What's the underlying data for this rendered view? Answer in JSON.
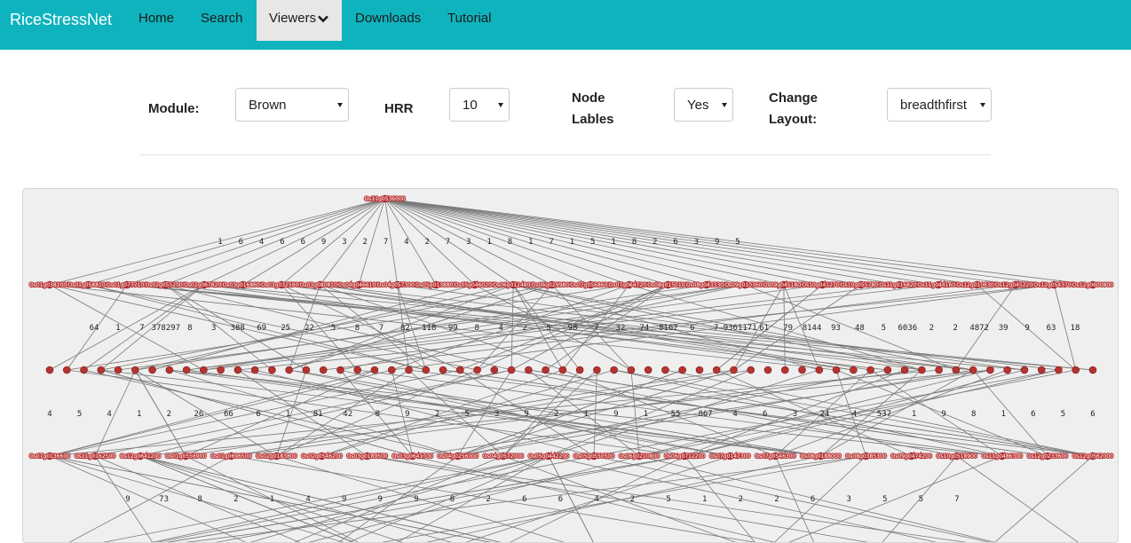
{
  "navbar": {
    "brand": "RiceStressNet",
    "items": [
      {
        "id": "home",
        "label": "Home"
      },
      {
        "id": "search",
        "label": "Search"
      },
      {
        "id": "viewers",
        "label": "Viewers",
        "active": true,
        "dropdown": true
      },
      {
        "id": "downloads",
        "label": "Downloads"
      },
      {
        "id": "tutorial",
        "label": "Tutorial"
      }
    ],
    "color": "#0fb3bd"
  },
  "controls": {
    "module_label": "Module:",
    "module_value": "Brown",
    "hrr_label": "HRR",
    "hrr_value": "10",
    "node_labels_label_line1": "Node",
    "node_labels_label_line2": "Lables",
    "node_labels_value": "Yes",
    "layout_label_line1": "Change",
    "layout_label_line2": "Layout:",
    "layout_value": "breadthfirst"
  },
  "graph": {
    "layout": "breadthfirst",
    "node_color": "#b83232",
    "edge_color": "#7a7a7a",
    "root_label": "Os11g0536000",
    "layer_sizes": [
      1,
      28,
      62,
      24,
      20
    ],
    "layer1_edge_labels": [
      "1",
      "6",
      "4",
      "6",
      "6",
      "9",
      "3",
      "2",
      "7",
      "4",
      "2",
      "7",
      "3",
      "1",
      "8",
      "1",
      "7",
      "1",
      "5",
      "1",
      "8",
      "2",
      "6",
      "3",
      "9",
      "5"
    ],
    "layer1_labels": [
      "Os01g0382000",
      "Os01g0588100",
      "Os01g0777100",
      "Os02g0552000",
      "Os02g0678200",
      "Os03g0168600",
      "Os03g0325900",
      "Os03g0808100",
      "Os04g0466100",
      "Os04g0573000",
      "Os05g0138800",
      "Os05g0460200",
      "Os06g0124800",
      "Os06g0299800",
      "Os07g0568600",
      "Os07g0647200",
      "Os08g0150100",
      "Os08g0433300",
      "Os09g0103600",
      "Os09g0451800",
      "Os10g0412700",
      "Os10g0557800",
      "Os11g0168200",
      "Os11g0441600",
      "Os12g0106300",
      "Os12g0452200",
      "Os12g0543700",
      "Os12g0600800"
    ],
    "layer2_edge_labels": [
      "64",
      "1",
      "7",
      "378297",
      "8",
      "3",
      "388",
      "69",
      "25",
      "22",
      "5",
      "8",
      "7",
      "82",
      "118",
      "99",
      "8",
      "4",
      "2",
      "5",
      "98",
      "7",
      "32",
      "74",
      "8162",
      "6",
      "7",
      "9361171",
      "61",
      "79",
      "8144",
      "93",
      "48",
      "5",
      "6036",
      "2",
      "2",
      "4872",
      "39",
      "9",
      "63",
      "18"
    ],
    "layer3_edge_labels": [
      "4",
      "5",
      "4",
      "1",
      "2",
      "26",
      "66",
      "6",
      "1",
      "81",
      "42",
      "8",
      "9",
      "2",
      "5",
      "3",
      "9",
      "2",
      "1",
      "9",
      "1",
      "55",
      "867",
      "4",
      "6",
      "3",
      "24",
      "4",
      "537",
      "1",
      "9",
      "8",
      "1",
      "6",
      "5",
      "6"
    ],
    "layer3_labels": [
      "Os07g0136600",
      "Os11g0162500",
      "Os12g0641200",
      "Os01g0556900",
      "Os01g0696500",
      "Os02g0183800",
      "Os02g0546200",
      "Os03g0189500",
      "Os03g0641700",
      "Os04g0256000",
      "Os04g0572000",
      "Os05g0442200",
      "Os05g0550500",
      "Os06g0210800",
      "Os06g0712200",
      "Os07g0147300",
      "Os07g0546300",
      "Os08g0188000",
      "Os08g0385300",
      "Os09g0474200",
      "Os10g0518900",
      "Os11g0486300",
      "Os12g0233600",
      "Os12g0562000"
    ],
    "layer4_edge_labels": [
      "9",
      "73",
      "8",
      "2",
      "1",
      "4",
      "9",
      "9",
      "9",
      "8",
      "2",
      "6",
      "6",
      "4",
      "2",
      "5",
      "1",
      "2",
      "2",
      "6",
      "3",
      "5",
      "5",
      "7"
    ]
  }
}
